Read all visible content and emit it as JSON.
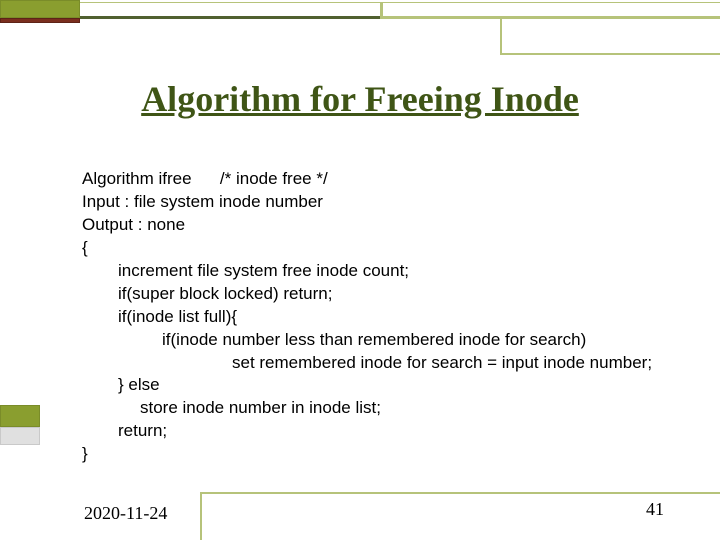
{
  "title": "Algorithm for Freeing Inode",
  "alg": {
    "l1": "Algorithm ifree      /* inode free */",
    "l2": "Input : file system inode number",
    "l3": "Output : none",
    "l4": "{",
    "l5": "increment file system free inode count;",
    "l6": "if(super block locked) return;",
    "l7": "if(inode list full){",
    "l8": "if(inode number less than remembered inode for search)",
    "l9": "set remembered inode for search = input inode number;",
    "l10": "} else",
    "l11": "store inode number in inode list;",
    "l12": "return;",
    "l13": "}"
  },
  "footer": {
    "date": "2020-11-24",
    "page": "41"
  }
}
